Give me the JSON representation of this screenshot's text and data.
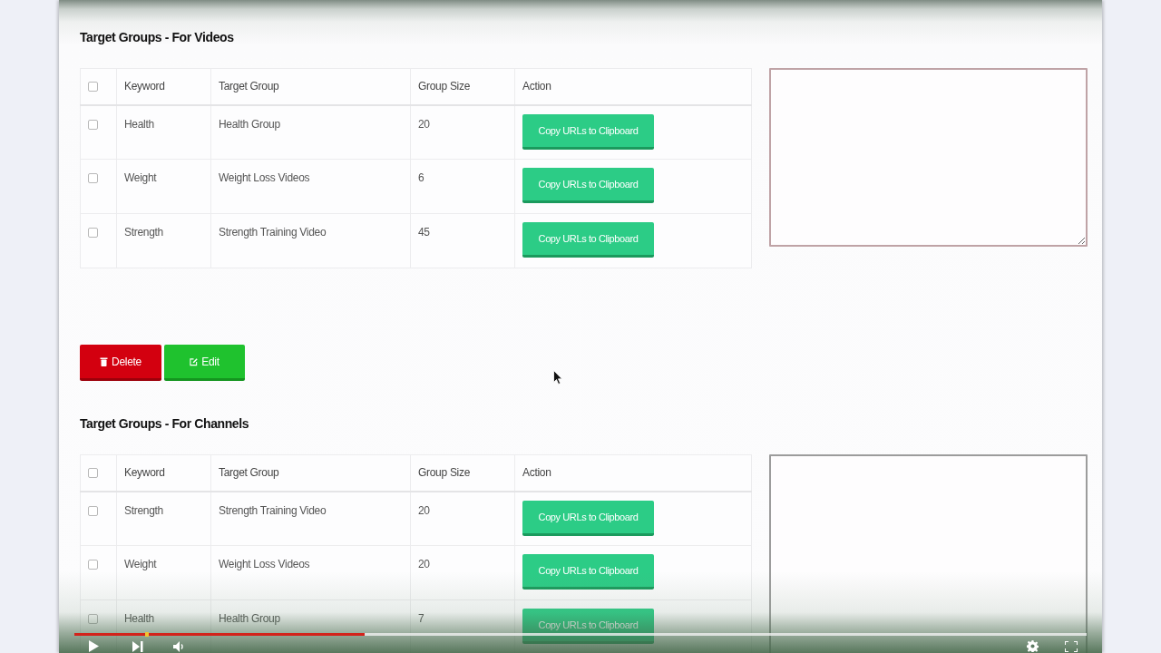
{
  "sections": [
    {
      "title": "Target Groups - For Videos",
      "table": {
        "select_all": {
          "checked": false
        },
        "columns": [
          "Keyword",
          "Target Group",
          "Group Size",
          "Action"
        ],
        "rows": [
          {
            "checked": false,
            "keyword": "Health",
            "target_group": "Health Group",
            "group_size": "20",
            "action": "Copy URLs to Clipboard"
          },
          {
            "checked": false,
            "keyword": "Weight",
            "target_group": "Weight Loss Videos",
            "group_size": "6",
            "action": "Copy URLs to Clipboard"
          },
          {
            "checked": false,
            "keyword": "Strength",
            "target_group": "Strength Training Video",
            "group_size": "45",
            "action": "Copy URLs to Clipboard"
          }
        ]
      },
      "textarea": {
        "highlighted": true
      },
      "buttons": [
        {
          "label": "Delete",
          "kind": "danger"
        },
        {
          "label": "Edit",
          "kind": "success"
        }
      ]
    },
    {
      "title": "Target Groups - For Channels",
      "table": {
        "select_all": {
          "checked": false
        },
        "columns": [
          "Keyword",
          "Target Group",
          "Group Size",
          "Action"
        ],
        "rows": [
          {
            "checked": false,
            "keyword": "Strength",
            "target_group": "Strength Training Video",
            "group_size": "20",
            "action": "Copy URLs to Clipboard"
          },
          {
            "checked": false,
            "keyword": "Weight",
            "target_group": "Weight Loss Videos",
            "group_size": "20",
            "action": "Copy URLs to Clipboard"
          },
          {
            "checked": false,
            "keyword": "Health",
            "target_group": "Health Group",
            "group_size": "7",
            "action": "Copy URLs to Clipboard"
          }
        ]
      },
      "textarea": {
        "highlighted": false
      }
    }
  ],
  "video_player": {
    "playing": false,
    "progress": {
      "level": 0.287
    }
  }
}
